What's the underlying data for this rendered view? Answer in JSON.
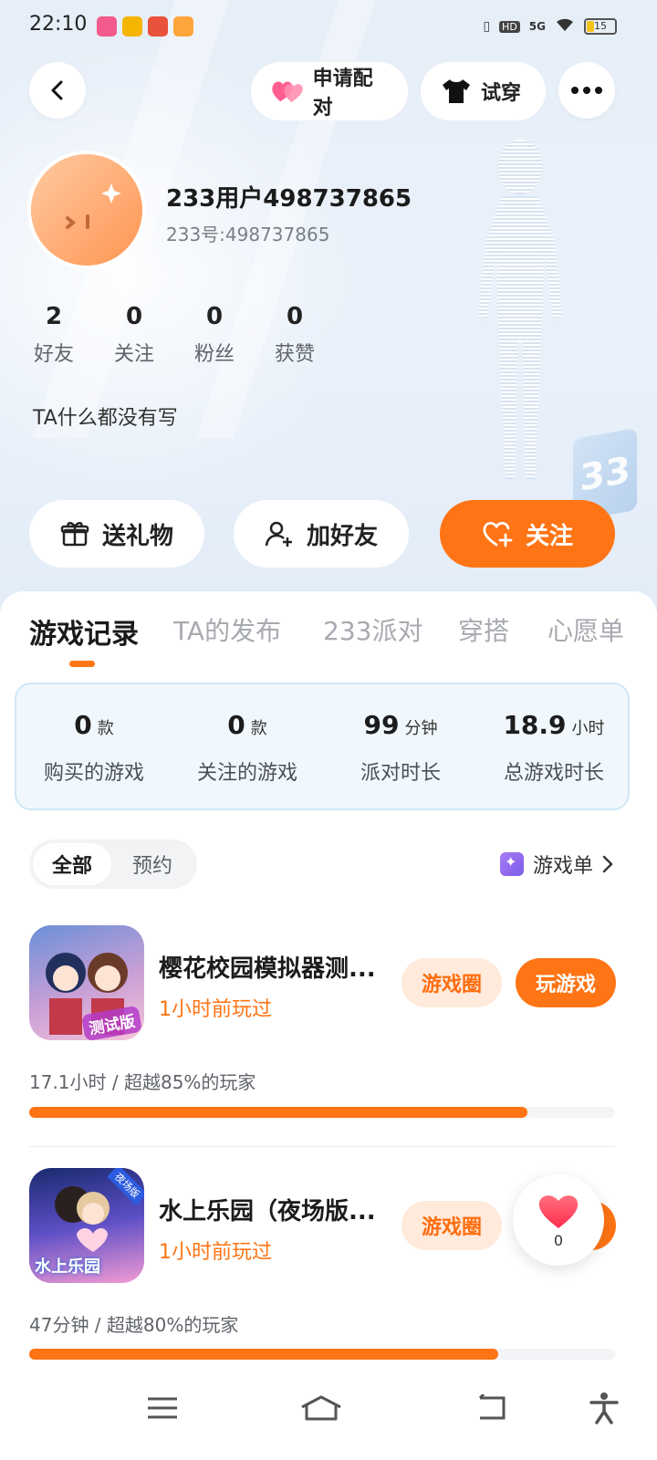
{
  "status_bar": {
    "time": "22:10",
    "network": "5G",
    "hd": "HD",
    "battery": "15"
  },
  "header": {
    "match_label": "申请配对",
    "try_on_label": "试穿"
  },
  "profile": {
    "username": "233用户498737865",
    "user_id": "233号:498737865",
    "stats": [
      {
        "value": "2",
        "label": "好友"
      },
      {
        "value": "0",
        "label": "关注"
      },
      {
        "value": "0",
        "label": "粉丝"
      },
      {
        "value": "0",
        "label": "获赞"
      }
    ],
    "bio": "TA什么都没有写"
  },
  "actions": {
    "gift_label": "送礼物",
    "add_friend_label": "加好友",
    "follow_label": "关注"
  },
  "tabs": [
    {
      "label": "游戏记录"
    },
    {
      "label": "TA的发布"
    },
    {
      "label": "233派对"
    },
    {
      "label": "穿搭"
    },
    {
      "label": "心愿单"
    }
  ],
  "summary": [
    {
      "value": "0",
      "unit": "款",
      "label": "购买的游戏"
    },
    {
      "value": "0",
      "unit": "款",
      "label": "关注的游戏"
    },
    {
      "value": "99",
      "unit": "分钟",
      "label": "派对时长"
    },
    {
      "value": "18.9",
      "unit": "小时",
      "label": "总游戏时长"
    }
  ],
  "filter": {
    "all_label": "全部",
    "reserve_label": "预约",
    "gamelist_label": "游戏单"
  },
  "games": [
    {
      "title": "樱花校园模拟器测...",
      "last_played": "1小时前玩过",
      "circle_label": "游戏圈",
      "play_label": "玩游戏",
      "stats_text": "17.1小时 / 超越85%的玩家",
      "progress": 0.85,
      "icon_badge": "测试版"
    },
    {
      "title": "水上乐园（夜场版...",
      "last_played": "1小时前玩过",
      "circle_label": "游戏圈",
      "stats_text": "47分钟 / 超越80%的玩家",
      "progress": 0.8,
      "icon_badge": "水上乐园",
      "icon_corner": "夜场版"
    }
  ],
  "like_widget": {
    "count": "0"
  },
  "colors": {
    "accent": "#ff7414",
    "accent_light": "#ffeadb"
  }
}
